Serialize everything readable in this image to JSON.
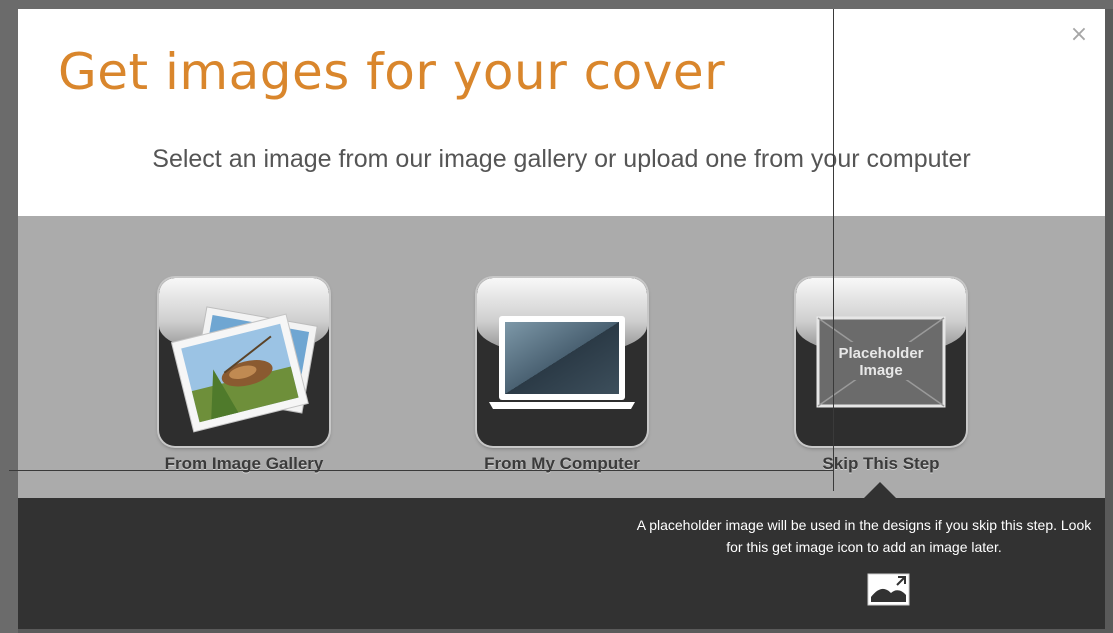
{
  "dialog": {
    "title": "Get images for your cover",
    "subtitle": "Select an image from our image gallery or upload one from your computer",
    "close_label": "×"
  },
  "options": [
    {
      "label": "From Image Gallery",
      "icon": "photo-stack-icon"
    },
    {
      "label": "From My Computer",
      "icon": "laptop-icon"
    },
    {
      "label": "Skip This Step",
      "icon": "placeholder-image-icon",
      "placeholder_text": "Placeholder Image"
    }
  ],
  "info": {
    "text": "A placeholder image will be used in the designs if you skip this step. Look for this get image icon to add an image later.",
    "icon": "get-image-icon"
  },
  "colors": {
    "title": "#d9862c",
    "options_band": "#ababab",
    "info_panel": "#323232"
  }
}
